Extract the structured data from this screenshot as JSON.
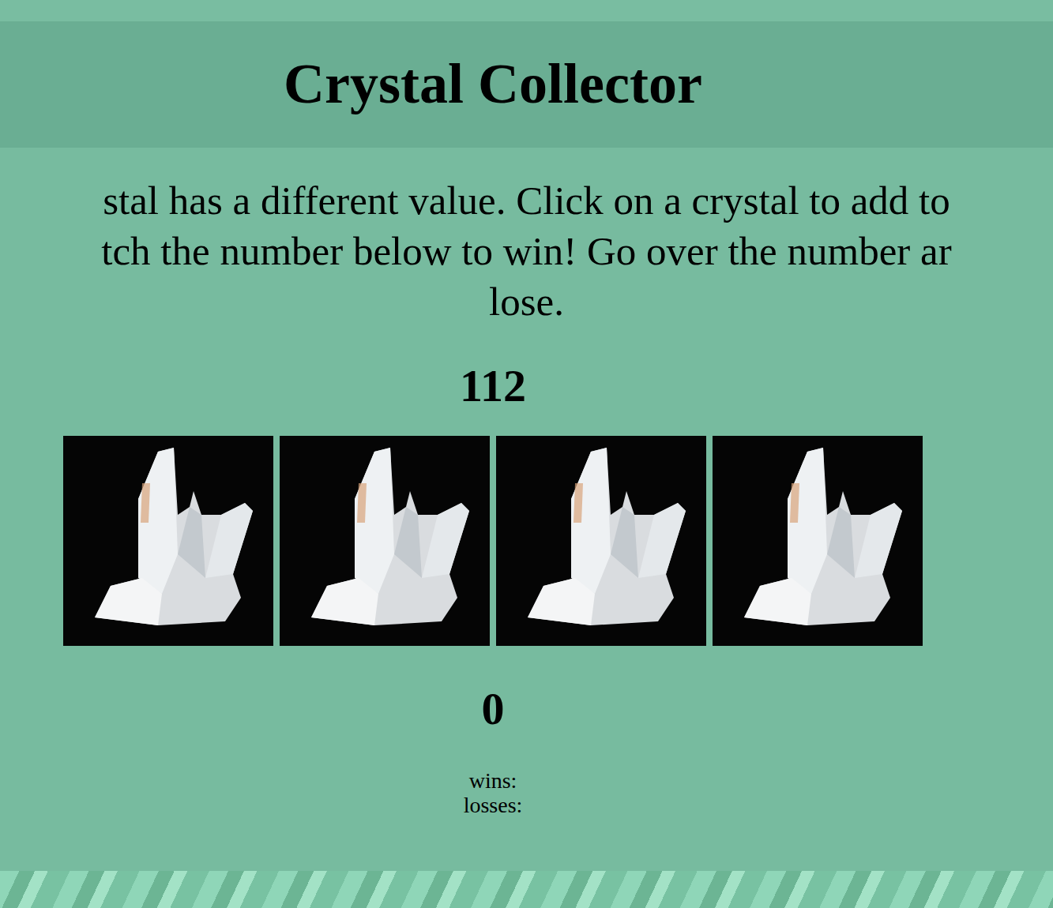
{
  "title": "Crystal Collector",
  "instructions": [
    "stal has a different value. Click on a crystal to add to",
    "tch the number below to win! Go over the number ar",
    "lose."
  ],
  "target": "112",
  "crystals": [
    {},
    {},
    {},
    {}
  ],
  "score": "0",
  "wins_label": "wins:",
  "losses_label": "losses:"
}
